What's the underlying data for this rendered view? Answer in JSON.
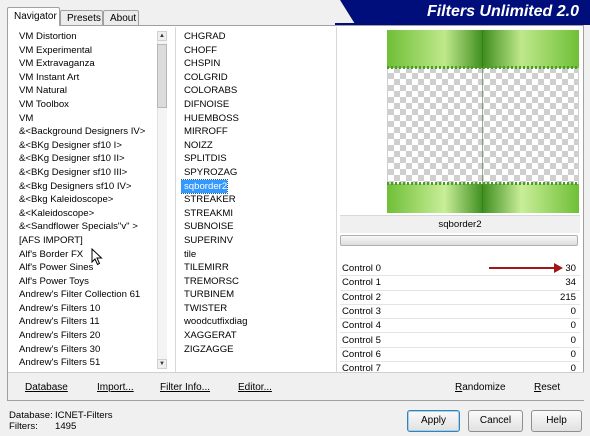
{
  "window": {
    "banner_title": "Filters Unlimited 2.0"
  },
  "tabs": [
    {
      "label": "Navigator",
      "active": true
    },
    {
      "label": "Presets",
      "active": false
    },
    {
      "label": "About",
      "active": false
    }
  ],
  "categories": [
    "VM Distortion",
    "VM Experimental",
    "VM Extravaganza",
    "VM Instant Art",
    "VM Natural",
    "VM Toolbox",
    "VM",
    "&<Background Designers IV>",
    "&<BKg Designer sf10 I>",
    "&<BKg Designer sf10 II>",
    "&<BKg Designer sf10 III>",
    "&<Bkg Designers sf10 IV>",
    "&<Bkg Kaleidoscope>",
    "&<Kaleidoscope>",
    "&<Sandflower Specials\"v\" >",
    "[AFS IMPORT]",
    "Alf's Border FX",
    "Alf's Power Sines",
    "Alf's Power Toys",
    "Andrew's Filter Collection 61",
    "Andrew's Filters 10",
    "Andrew's Filters 11",
    "Andrew's Filters 20",
    "Andrew's Filters 30",
    "Andrew's Filters 51"
  ],
  "filters": [
    "CHGRAD",
    "CHOFF",
    "CHSPIN",
    "COLGRID",
    "COLORABS",
    "DIFNOISE",
    "HUEMBOSS",
    "MIRROFF",
    "NOIZZ",
    "SPLITDIS",
    "SPYROZAG",
    "sqborder2",
    "STREAKER",
    "STREAKMI",
    "SUBNOISE",
    "SUPERINV",
    "tile",
    "TILEMIRR",
    "TREMORSC",
    "TURBINEM",
    "TWISTER",
    "woodcutfixdiag",
    "XAGGERAT",
    "ZIGZAGGE"
  ],
  "selected_filter_index": 11,
  "preview_label": "sqborder2",
  "controls": [
    {
      "label": "Control 0",
      "value": "30"
    },
    {
      "label": "Control 1",
      "value": "34"
    },
    {
      "label": "Control 2",
      "value": "215"
    },
    {
      "label": "Control 3",
      "value": "0"
    },
    {
      "label": "Control 4",
      "value": "0"
    },
    {
      "label": "Control 5",
      "value": "0"
    },
    {
      "label": "Control 6",
      "value": "0"
    },
    {
      "label": "Control 7",
      "value": "0"
    }
  ],
  "link_buttons": {
    "database": "Database",
    "import": "Import...",
    "filter_info": "Filter Info...",
    "editor": "Editor...",
    "randomize": "Randomize",
    "reset": "Reset"
  },
  "status": {
    "database_label": "Database:",
    "database_value": "ICNET-Filters",
    "filters_label": "Filters:",
    "filters_value": "1495"
  },
  "dialog_buttons": {
    "apply": "Apply",
    "cancel": "Cancel",
    "help": "Help"
  },
  "colors": {
    "banner": "#000e7c",
    "selection": "#3399ff",
    "arrow": "#a31616"
  }
}
